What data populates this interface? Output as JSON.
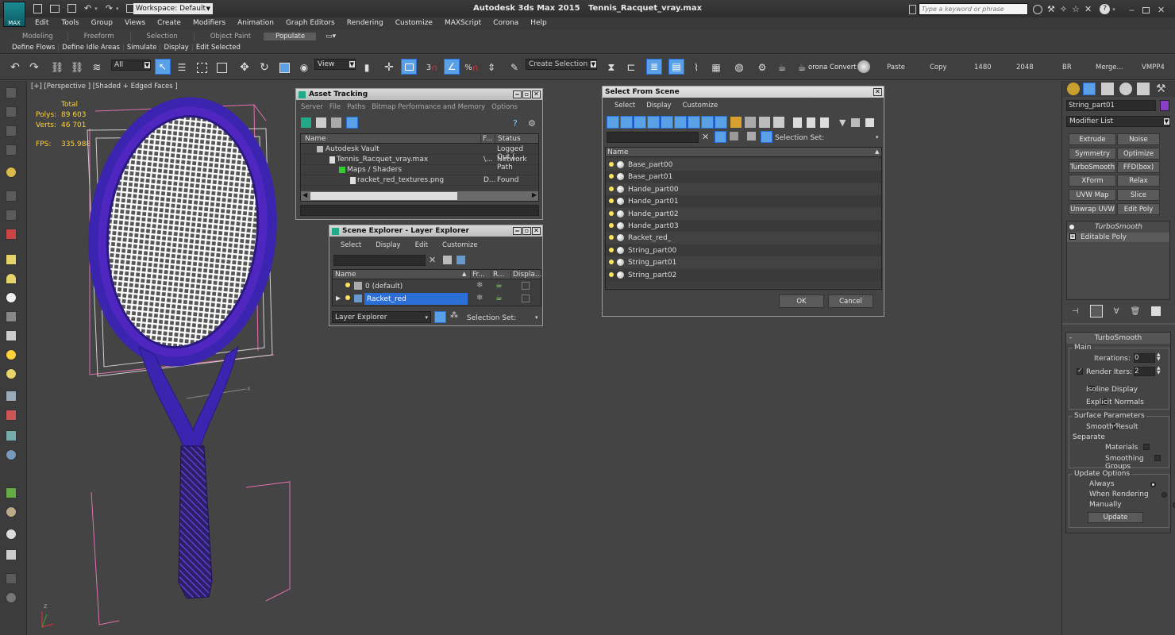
{
  "title_bar": {
    "app": "Autodesk 3ds Max  2015",
    "file": "Tennis_Racquet_vray.max",
    "workspace": "Workspace: Default",
    "search_placeholder": "Type a keyword or phrase",
    "logo": "MAX"
  },
  "menu": [
    "Edit",
    "Tools",
    "Group",
    "Views",
    "Create",
    "Modifiers",
    "Animation",
    "Graph Editors",
    "Rendering",
    "Customize",
    "MAXScript",
    "Corona",
    "Help"
  ],
  "ribbon_tabs": [
    "Modeling",
    "Freeform",
    "Selection",
    "Object Paint",
    "Populate"
  ],
  "ribbon_buttons": [
    "Define Flows",
    "Define Idle Areas",
    "Simulate",
    "Display",
    "Edit Selected"
  ],
  "toolbar": {
    "filter": "All",
    "ref_coord": "View",
    "named_sel_placeholder": "Create Selection Se",
    "corona_convert": "orona Convert",
    "paste": "Paste",
    "copy": "Copy",
    "w": "1480",
    "h": "2048",
    "br": "BR",
    "merge": "Merge...",
    "vmpp": "VMPP4",
    "snap_3": "3",
    "snap_pct": "%"
  },
  "viewport": {
    "label": "[+] [Perspective ] [Shaded + Edged Faces ]",
    "stats_header": "Total",
    "stats": [
      {
        "label": "Polys:",
        "value": "89 603"
      },
      {
        "label": "Verts:",
        "value": "46 701"
      }
    ],
    "fps_label": "FPS:",
    "fps_value": "335.988",
    "axis_x": "x",
    "axis_z": "z"
  },
  "asset_tracking": {
    "title": "Asset Tracking",
    "menu": [
      "Server",
      "File",
      "Paths",
      "Bitmap Performance and Memory",
      "Options"
    ],
    "columns": [
      "Name",
      "F...",
      "Status"
    ],
    "rows": [
      {
        "name": "Autodesk Vault",
        "f": "",
        "status": "Logged Out (..."
      },
      {
        "name": "Tennis_Racquet_vray.max",
        "f": "\\...",
        "status": "Network Path"
      },
      {
        "name": "Maps / Shaders",
        "f": "",
        "status": ""
      },
      {
        "name": "racket_red_textures.png",
        "f": "D...",
        "status": "Found"
      }
    ]
  },
  "scene_explorer": {
    "title": "Scene Explorer - Layer Explorer",
    "menu": [
      "Select",
      "Display",
      "Edit",
      "Customize"
    ],
    "columns": [
      "Name",
      "Fr...",
      "R...",
      "Displa..."
    ],
    "rows": [
      {
        "name": "0 (default)"
      },
      {
        "name": "Racket_red"
      }
    ],
    "explorer_select": "Layer Explorer",
    "selection_set_label": "Selection Set:"
  },
  "select_from_scene": {
    "title": "Select From Scene",
    "menu": [
      "Select",
      "Display",
      "Customize"
    ],
    "selection_set_label": "Selection Set:",
    "column": "Name",
    "items": [
      "Base_part00",
      "Base_part01",
      "Hande_part00",
      "Hande_part01",
      "Hande_part02",
      "Hande_part03",
      "Racket_red_",
      "String_part00",
      "String_part01",
      "String_part02"
    ],
    "ok": "OK",
    "cancel": "Cancel"
  },
  "command_panel": {
    "object_name": "String_part01",
    "object_color": "#8a3fc4",
    "modifier_list": "Modifier List",
    "modifier_buttons": [
      "Extrude",
      "Noise",
      "Symmetry",
      "Optimize",
      "TurboSmooth",
      "FFD(box)",
      "XForm",
      "Relax",
      "UVW Map",
      "Slice",
      "Unwrap UVW",
      "Edit Poly"
    ],
    "stack": [
      "TurboSmooth",
      "Editable Poly"
    ],
    "rollout_title": "TurboSmooth",
    "main_group": "Main",
    "iterations_label": "Iterations:",
    "iterations_value": "0",
    "render_iters_label": "Render Iters:",
    "render_iters_value": "2",
    "isoline": "Isoline Display",
    "explicit": "Explicit Normals",
    "surface_group": "Surface Parameters",
    "smooth_result": "Smooth Result",
    "separate": "Separate",
    "materials": "Materials",
    "smoothing_groups": "Smoothing Groups",
    "update_group": "Update Options",
    "always": "Always",
    "when_rendering": "When Rendering",
    "manually": "Manually",
    "update_btn": "Update",
    "rollout_toggle": "-"
  },
  "colors": {
    "accent": "#2b6fd6",
    "wire": "#5a28c8",
    "string": "#ffffff"
  }
}
